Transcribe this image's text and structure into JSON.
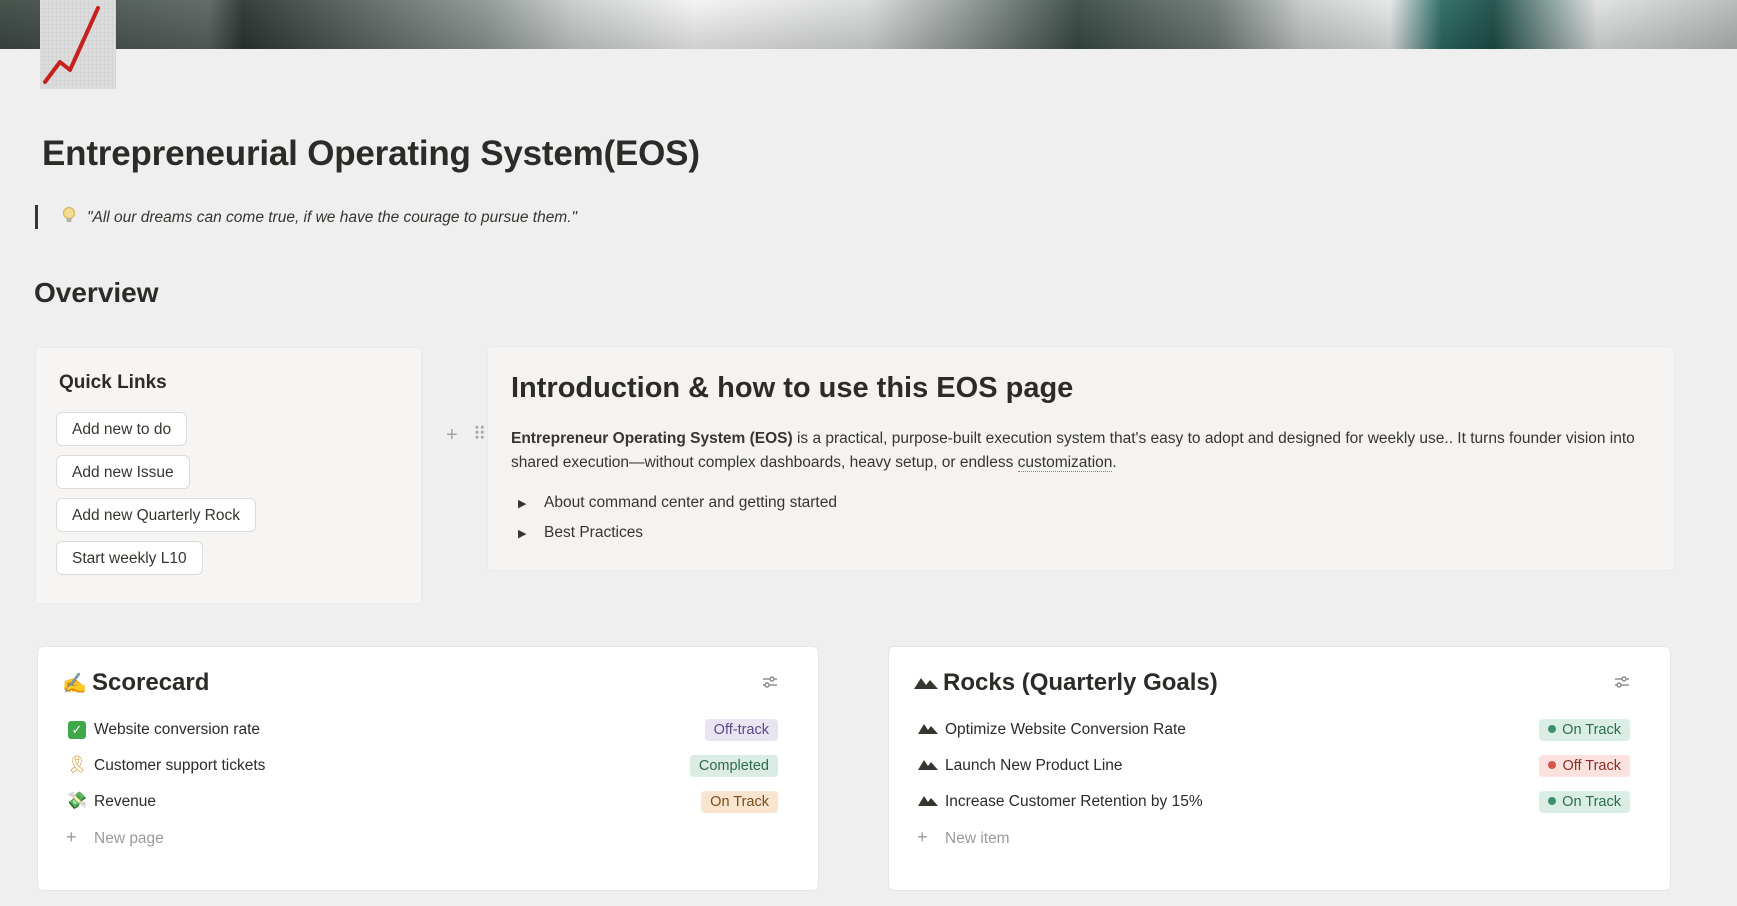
{
  "page": {
    "title": "Entrepreneurial Operating System(EOS)",
    "icon": "chart-increasing-icon",
    "quote_icon": "light-bulb-icon",
    "quote": "\"All our dreams can come true, if we have the courage to pursue them.\"",
    "section_heading": "Overview"
  },
  "quick_links": {
    "title": "Quick Links",
    "buttons": [
      "Add new to do",
      "Add new Issue",
      "Add new Quarterly Rock",
      "Start weekly L10"
    ]
  },
  "intro": {
    "title": "Introduction & how to use this EOS page",
    "body_bold": "Entrepreneur Operating System (EOS)",
    "body_rest": " is a practical, purpose-built execution system that's easy to adopt and designed for weekly use.. It turns founder vision into shared execution—without complex dashboards, heavy setup, or endless ",
    "body_link": "customization",
    "body_end": ".",
    "toggles": [
      "About command center and getting started",
      "Best Practices"
    ]
  },
  "scorecard": {
    "icon": "writing-hand-icon",
    "title": "Scorecard",
    "rows": [
      {
        "icon": "check-mark-icon",
        "name": "Website conversion rate",
        "status": "Off-track"
      },
      {
        "icon": "ribbon-icon",
        "name": "Customer support tickets",
        "status": "Completed"
      },
      {
        "icon": "money-with-wings-icon",
        "name": "Revenue",
        "status": "On Track"
      }
    ],
    "new_label": "New page"
  },
  "rocks": {
    "icon": "mountains-icon",
    "title": "Rocks (Quarterly Goals)",
    "rows": [
      {
        "icon": "mountain-icon",
        "name": "Optimize Website Conversion Rate",
        "status": "On Track"
      },
      {
        "icon": "mountain-icon",
        "name": "Launch New Product Line",
        "status": "Off Track"
      },
      {
        "icon": "mountain-icon",
        "name": "Increase Customer Retention by 15%",
        "status": "On Track"
      }
    ],
    "new_label": "New item"
  },
  "colors": {
    "off_track_purple_bg": "#e8e4f2",
    "off_track_purple_fg": "#5d4a86",
    "completed_bg": "#dbece4",
    "completed_fg": "#2f6a50",
    "on_track_orange_bg": "#f8e5cf",
    "on_track_orange_fg": "#7b4d1e",
    "on_track_green_bg": "#dbeee5",
    "on_track_green_fg": "#2e6b51",
    "off_track_red_bg": "#fbe2df",
    "off_track_red_fg": "#8a2f26"
  }
}
